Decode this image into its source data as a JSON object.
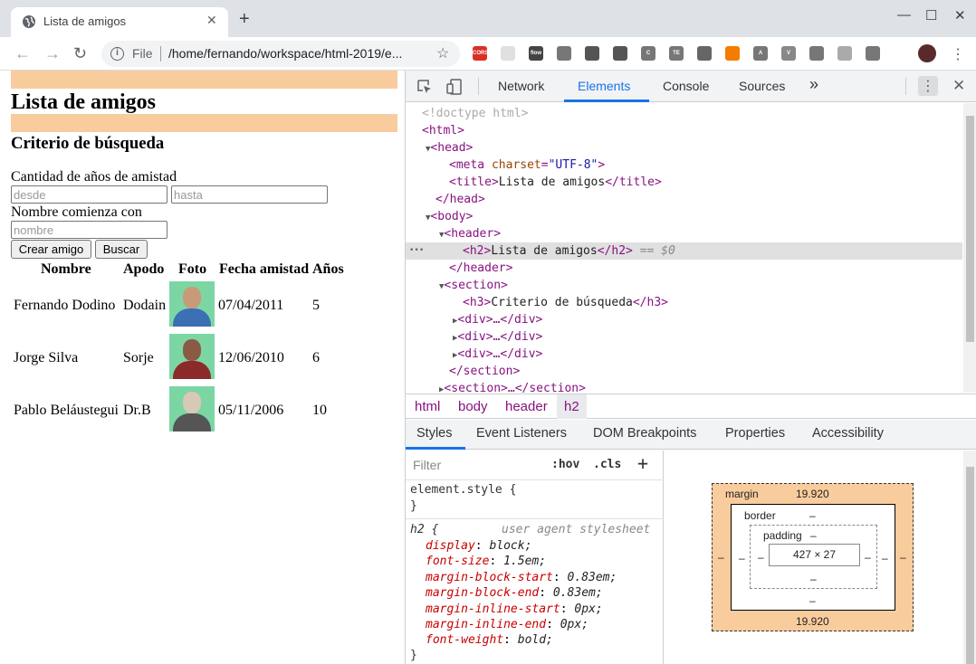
{
  "browser": {
    "tab_title": "Lista de amigos",
    "tab_close": "✕",
    "new_tab": "+",
    "window_controls": {
      "minimize": "—",
      "maximize": "☐",
      "close": "✕"
    },
    "back": "←",
    "forward": "→",
    "reload": "↻",
    "scheme_label": "File",
    "url": "/home/fernando/workspace/html-2019/e...",
    "bookmark": "☆",
    "menu": "⋮",
    "extensions": [
      {
        "name": "cors-extension-icon",
        "label": "CORS",
        "color": "#d93025"
      },
      {
        "name": "qr-extension-icon",
        "label": "",
        "color": "#e0e0e0"
      },
      {
        "name": "flow-extension-icon",
        "label": "flow",
        "color": "#444444"
      },
      {
        "name": "vue-devtools-icon",
        "label": "",
        "color": "#777777"
      },
      {
        "name": "cube-extension-icon",
        "label": "",
        "color": "#555555"
      },
      {
        "name": "grid-extension-icon",
        "label": "",
        "color": "#555555"
      },
      {
        "name": "c-extension-icon",
        "label": "C",
        "color": "#777777"
      },
      {
        "name": "te-extension-icon",
        "label": "TE",
        "color": "#777777"
      },
      {
        "name": "image-extension-icon",
        "label": "",
        "color": "#666666"
      },
      {
        "name": "orange-extension-icon",
        "label": "",
        "color": "#f57c00"
      },
      {
        "name": "a-extension-icon",
        "label": "A",
        "color": "#777777"
      },
      {
        "name": "v-extension-icon",
        "label": "V",
        "color": "#888888"
      },
      {
        "name": "bulb-extension-icon",
        "label": "",
        "color": "#777777"
      },
      {
        "name": "timer-extension-icon",
        "label": "",
        "color": "#aaaaaa"
      },
      {
        "name": "doc-extension-icon",
        "label": "",
        "color": "#777777"
      }
    ]
  },
  "page": {
    "title": "Lista de amigos",
    "section_title": "Criterio de búsqueda",
    "label_years": "Cantidad de años de amistad",
    "placeholder_from": "desde",
    "placeholder_to": "hasta",
    "label_name": "Nombre comienza con",
    "placeholder_name": "nombre",
    "btn_create": "Crear amigo",
    "btn_search": "Buscar",
    "band_color": "#f9cc9d",
    "table": {
      "headers": [
        "Nombre",
        "Apodo",
        "Foto",
        "Fecha amistad",
        "Años"
      ],
      "rows": [
        {
          "nombre": "Fernando Dodino",
          "apodo": "Dodain",
          "fecha": "07/04/2011",
          "anios": "5"
        },
        {
          "nombre": "Jorge Silva",
          "apodo": "Sorje",
          "fecha": "12/06/2010",
          "anios": "6"
        },
        {
          "nombre": "Pablo Beláustegui",
          "apodo": "Dr.B",
          "fecha": "05/11/2006",
          "anios": "10"
        }
      ]
    }
  },
  "devtools": {
    "tabs": [
      "Network",
      "Elements",
      "Console",
      "Sources"
    ],
    "more_tabs": "»",
    "active_tab": "Elements",
    "close": "✕",
    "menu": "⋮",
    "dom": {
      "doctype": "<!doctype html>",
      "html_open": "<html>",
      "head_open": "<head>",
      "meta": {
        "tag": "meta",
        "attr": "charset",
        "value": "\"UTF-8\""
      },
      "title_text": "Lista de amigos",
      "head_close": "</head>",
      "body_open": "<body>",
      "header_open": "<header>",
      "h2_text": "Lista de amigos",
      "selected_marker": "== $0",
      "gutter_dots": "•••",
      "header_close": "</header>",
      "section_open": "<section>",
      "h3_text": "Criterio de búsqueda",
      "div_collapsed": "<div>…</div>",
      "section_close": "</section>",
      "section_collapsed": "<section>…</section>"
    },
    "breadcrumbs": [
      "html",
      "body",
      "header",
      "h2"
    ],
    "sub_tabs": [
      "Styles",
      "Event Listeners",
      "DOM Breakpoints",
      "Properties",
      "Accessibility"
    ],
    "active_sub_tab": "Styles",
    "styles": {
      "filter_placeholder": "Filter",
      "hov": ":hov",
      "cls": ".cls",
      "add": "+",
      "element_style": "element.style {",
      "close_brace": "}",
      "h2_selector": "h2 {",
      "ua_label": "user agent stylesheet",
      "props": [
        {
          "name": "display",
          "value": "block;"
        },
        {
          "name": "font-size",
          "value": "1.5em;"
        },
        {
          "name": "margin-block-start",
          "value": "0.83em;"
        },
        {
          "name": "margin-block-end",
          "value": "0.83em;"
        },
        {
          "name": "margin-inline-start",
          "value": "0px;"
        },
        {
          "name": "margin-inline-end",
          "value": "0px;"
        },
        {
          "name": "font-weight",
          "value": "bold;"
        }
      ]
    },
    "box_model": {
      "margin_label": "margin",
      "margin_top": "19.920",
      "margin_bottom": "19.920",
      "border_label": "border",
      "padding_label": "padding",
      "dash": "–",
      "content": "427 × 27"
    }
  }
}
